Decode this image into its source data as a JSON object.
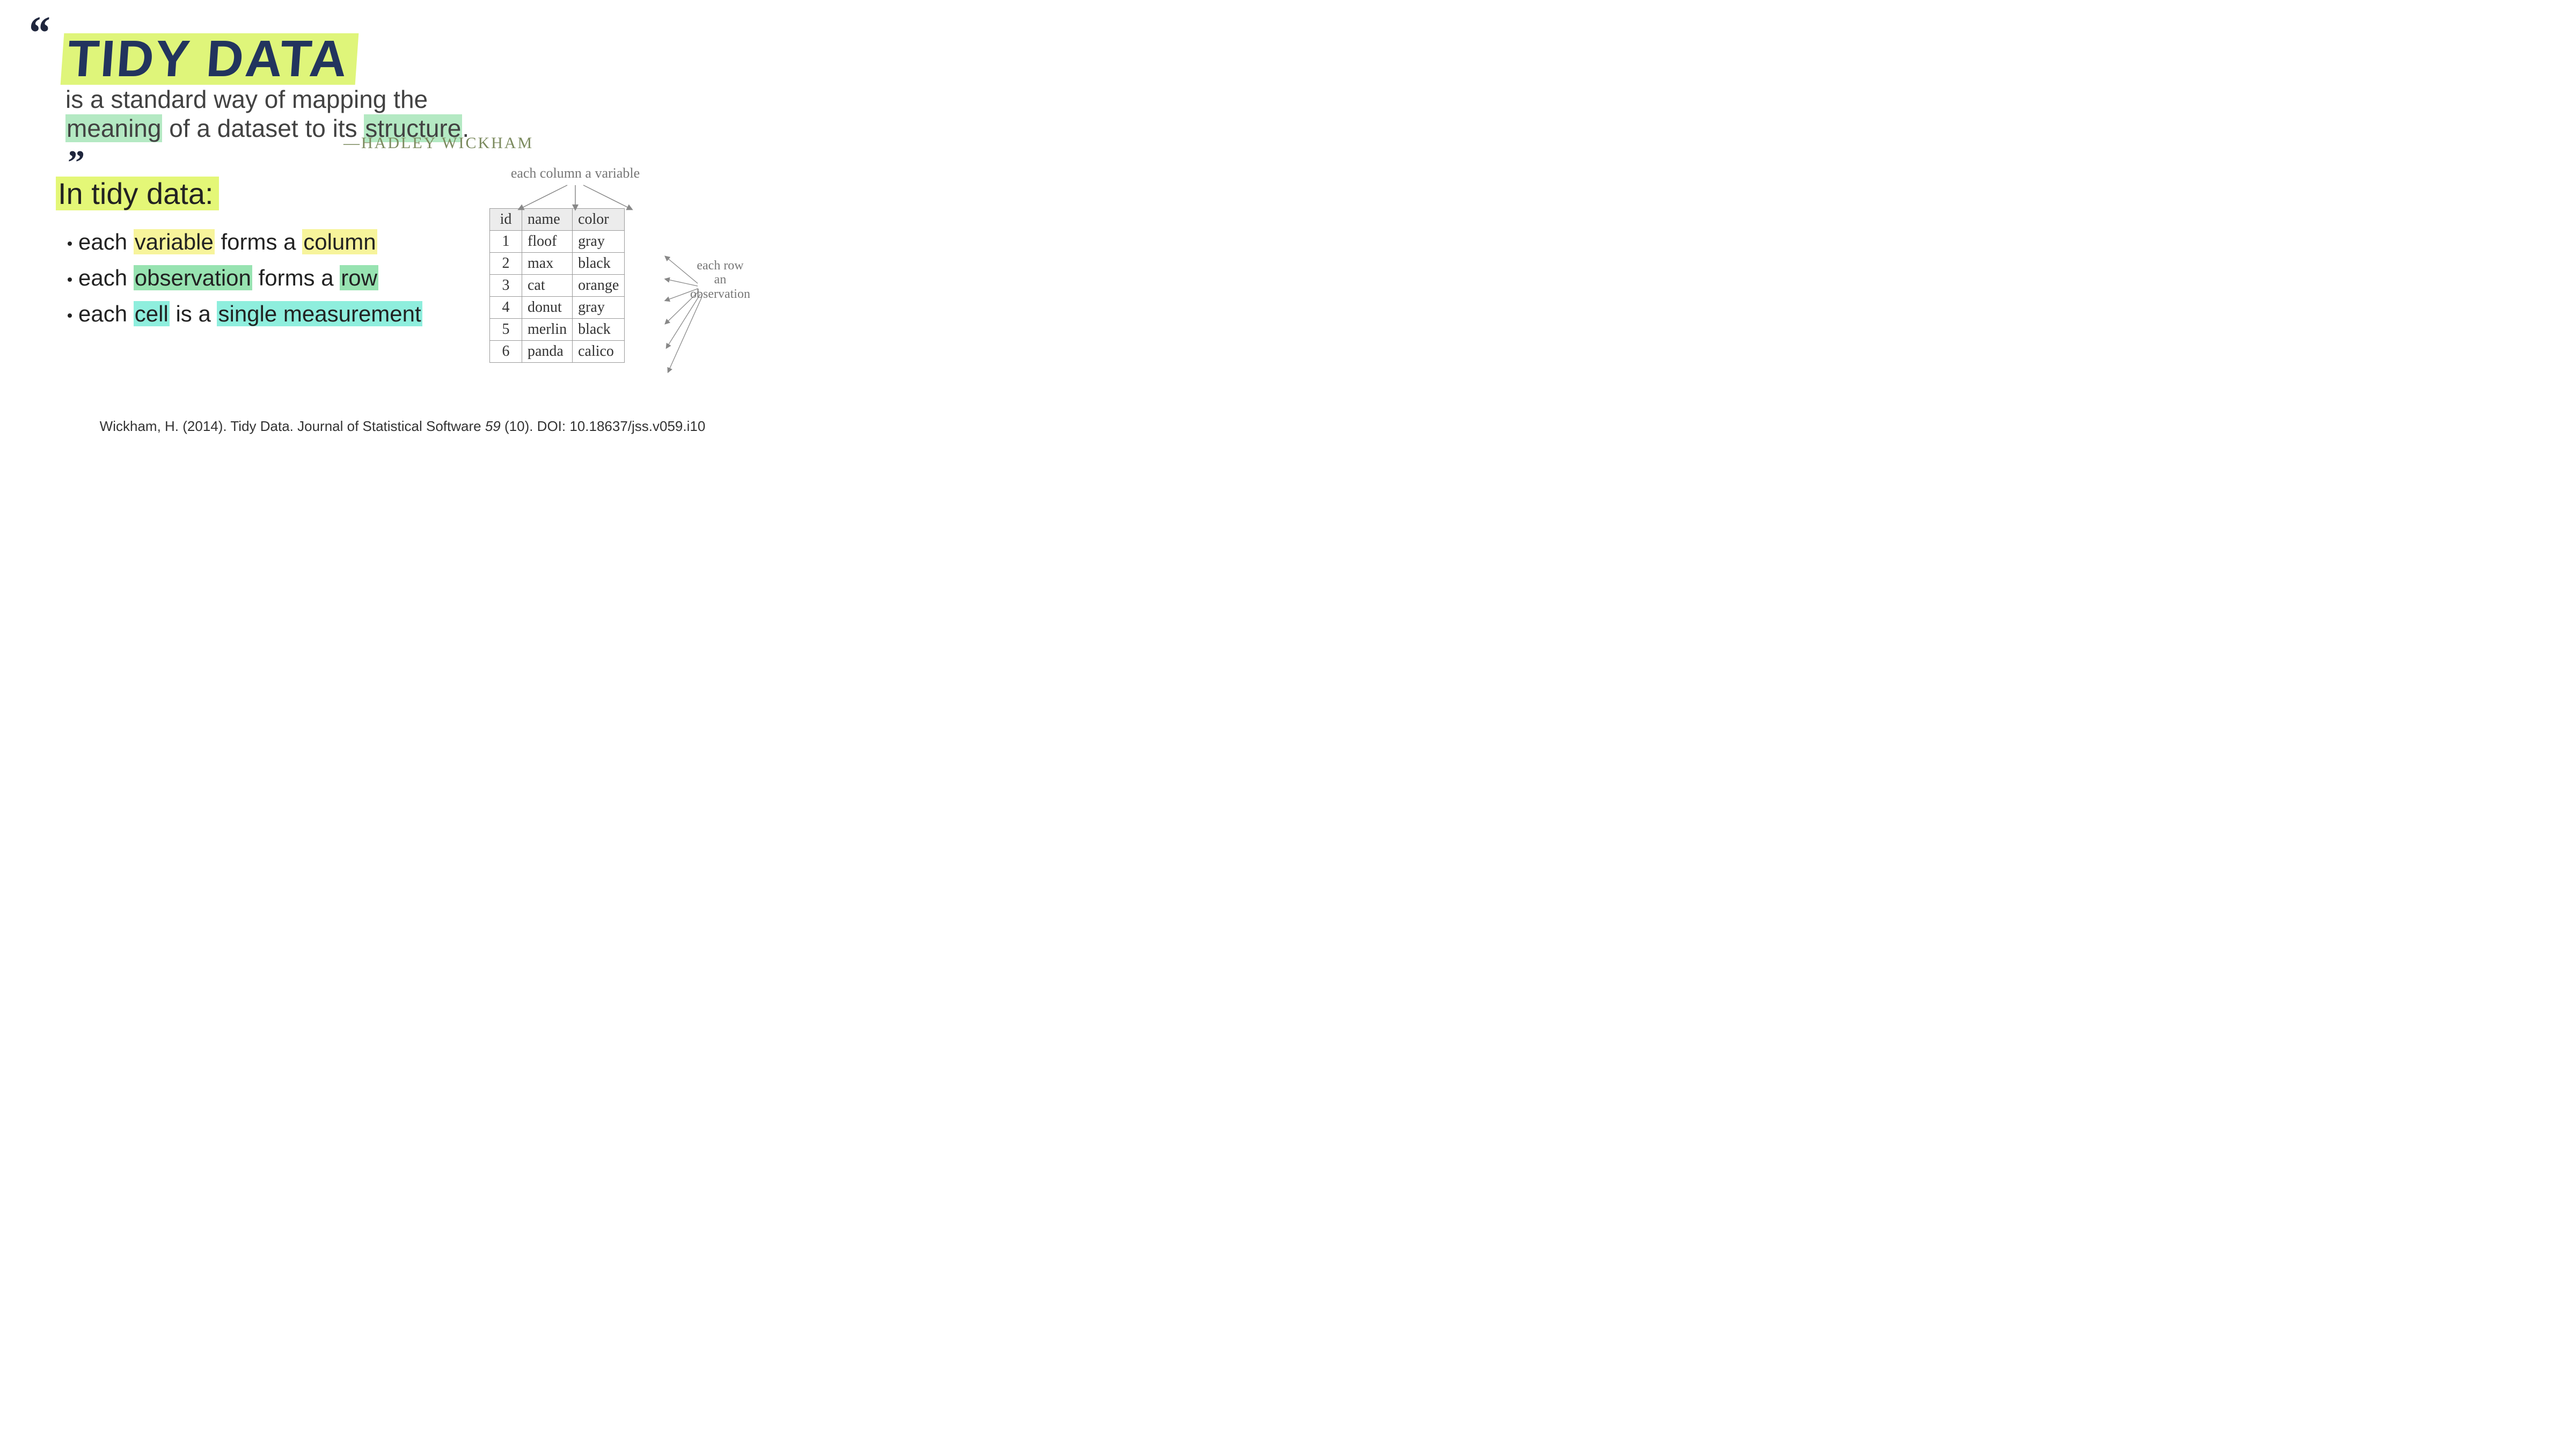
{
  "quote": {
    "title": "TIDY DATA",
    "line": "is a standard way of mapping the meaning of a dataset to its structure.",
    "hl_meaning": "meaning",
    "hl_structure": "structure",
    "attribution": "—HADLEY WICKHAM"
  },
  "subhead": "In tidy data:",
  "bullets": [
    {
      "pre": "each ",
      "h1": "variable",
      "h1style": "hl-yellow",
      "mid": " forms a ",
      "h2": "column",
      "h2style": "hl-yellow",
      "post": ""
    },
    {
      "pre": "each ",
      "h1": "observation",
      "h1style": "hl-green",
      "mid": " forms a ",
      "h2": "row",
      "h2style": "hl-green",
      "post": ""
    },
    {
      "pre": "each ",
      "h1": "cell",
      "h1style": "hl-cyan",
      "mid": " is a ",
      "h2": "single measurement",
      "h2style": "hl-cyan",
      "post": ""
    }
  ],
  "table": {
    "columns": [
      "id",
      "name",
      "color"
    ],
    "rows": [
      {
        "id": "1",
        "name": "floof",
        "color": "gray"
      },
      {
        "id": "2",
        "name": "max",
        "color": "black"
      },
      {
        "id": "3",
        "name": "cat",
        "color": "orange"
      },
      {
        "id": "4",
        "name": "donut",
        "color": "gray"
      },
      {
        "id": "5",
        "name": "merlin",
        "color": "black"
      },
      {
        "id": "6",
        "name": "panda",
        "color": "calico"
      }
    ],
    "anno_top": "each column a variable",
    "anno_right_l1": "each row",
    "anno_right_l2": "an",
    "anno_right_l3": "observation"
  },
  "citation": {
    "text_pre": "Wickham, H. (2014). Tidy Data. Journal of Statistical Software ",
    "vol": "59",
    "issue": " (10). DOI: 10.18637/jss.v059.i10"
  }
}
